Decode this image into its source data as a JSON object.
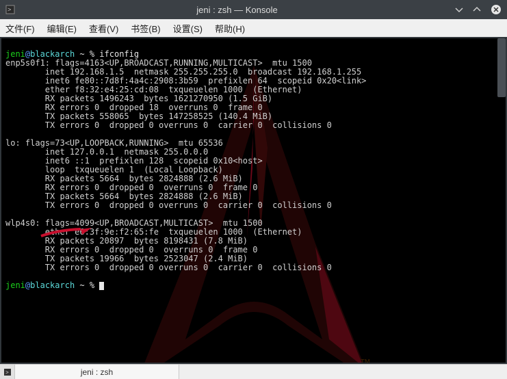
{
  "titlebar": {
    "title": "jeni : zsh — Konsole"
  },
  "menubar": {
    "file": "文件(F)",
    "edit": "编辑(E)",
    "view": "查看(V)",
    "bookmarks": "书签(B)",
    "settings": "设置(S)",
    "help": "帮助(H)"
  },
  "prompt1": {
    "user": "jeni",
    "at": "@",
    "host": "blackarch",
    "sep": " ~ % ",
    "cmd": "ifconfig"
  },
  "output": {
    "l01": "enp5s0f1: flags=4163<UP,BROADCAST,RUNNING,MULTICAST>  mtu 1500",
    "l02": "        inet 192.168.1.5  netmask 255.255.255.0  broadcast 192.168.1.255",
    "l03": "        inet6 fe80::7d8f:4a4c:2908:3b59  prefixlen 64  scopeid 0x20<link>",
    "l04": "        ether f8:32:e4:25:cd:08  txqueuelen 1000  (Ethernet)",
    "l05": "        RX packets 1496243  bytes 1621270950 (1.5 GiB)",
    "l06": "        RX errors 0  dropped 18  overruns 0  frame 0",
    "l07": "        TX packets 558065  bytes 147258525 (140.4 MiB)",
    "l08": "        TX errors 0  dropped 0 overruns 0  carrier 0  collisions 0",
    "l09": "",
    "l10": "lo: flags=73<UP,LOOPBACK,RUNNING>  mtu 65536",
    "l11": "        inet 127.0.0.1  netmask 255.0.0.0",
    "l12": "        inet6 ::1  prefixlen 128  scopeid 0x10<host>",
    "l13": "        loop  txqueuelen 1  (Local Loopback)",
    "l14": "        RX packets 5664  bytes 2824888 (2.6 MiB)",
    "l15": "        RX errors 0  dropped 0  overruns 0  frame 0",
    "l16": "        TX packets 5664  bytes 2824888 (2.6 MiB)",
    "l17": "        TX errors 0  dropped 0 overruns 0  carrier 0  collisions 0",
    "l18": "",
    "l19": "wlp4s0: flags=4099<UP,BROADCAST,MULTICAST>  mtu 1500",
    "l20": "        ether e6:3f:9e:f2:65:fe  txqueuelen 1000  (Ethernet)",
    "l21": "        RX packets 20897  bytes 8198431 (7.8 MiB)",
    "l22": "        RX errors 0  dropped 0  overruns 0  frame 0",
    "l23": "        TX packets 19966  bytes 2523047 (2.4 MiB)",
    "l24": "        TX errors 0  dropped 0 overruns 0  carrier 0  collisions 0",
    "l25": ""
  },
  "prompt2": {
    "user": "jeni",
    "at": "@",
    "host": "blackarch",
    "sep": " ~ % "
  },
  "statusbar": {
    "tab": "jeni : zsh"
  },
  "icons": {
    "new": "▸"
  },
  "colors": {
    "arrow": "#c8102e",
    "logo_main": "#3b0a0a",
    "logo_accent": "#c8102e",
    "logo_tm": "#6a3a00"
  }
}
